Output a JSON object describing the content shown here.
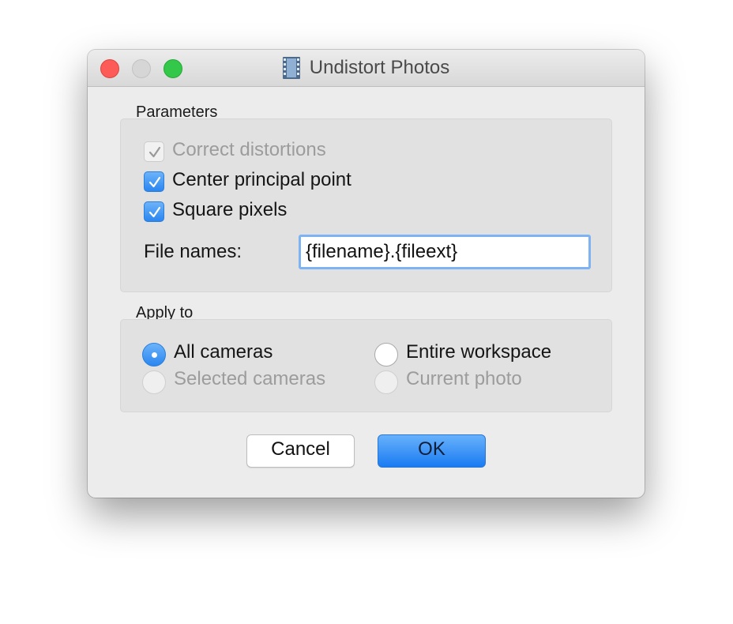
{
  "window": {
    "title": "Undistort Photos"
  },
  "parameters": {
    "group_label": "Parameters",
    "checkboxes": [
      {
        "label": "Correct distortions",
        "checked": true,
        "enabled": false
      },
      {
        "label": "Center principal point",
        "checked": true,
        "enabled": true
      },
      {
        "label": "Square pixels",
        "checked": true,
        "enabled": true
      }
    ],
    "file_names_label": "File names:",
    "file_names_value": "{filename}.{fileext}"
  },
  "apply_to": {
    "group_label": "Apply to",
    "options": [
      {
        "label": "All cameras",
        "selected": true,
        "enabled": true
      },
      {
        "label": "Selected cameras",
        "selected": false,
        "enabled": false
      },
      {
        "label": "Entire workspace",
        "selected": false,
        "enabled": true
      },
      {
        "label": "Current photo",
        "selected": false,
        "enabled": false
      }
    ]
  },
  "buttons": {
    "cancel": "Cancel",
    "ok": "OK"
  },
  "icons": {
    "title": "film-strip-icon",
    "close": "close-icon",
    "minimize": "minimize-icon",
    "zoom": "zoom-icon"
  },
  "colors": {
    "accent": "#2a86f0",
    "close": "#fc5b57",
    "zoom": "#34c84a"
  }
}
